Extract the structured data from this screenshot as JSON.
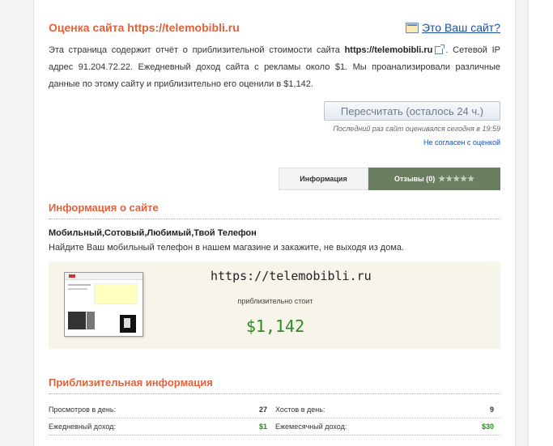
{
  "header": {
    "title": "Оценка сайта https://telemobibli.ru",
    "owner_link": "Это Ваш сайт?"
  },
  "description": {
    "part1": "Эта страница содержит отчёт о приблизительной стоимости сайта ",
    "site_bold": "https://telemobibli.ru",
    "part2": ". Сетевой IP адрес 91.204.72.22. Ежедневный доход сайта с рекламы около $1. Мы проанализировали различные данные по этому сайту и приблизительно его оценили в $1,142."
  },
  "actions": {
    "recalc_label": "Пересчитать (осталось 24 ч.)",
    "last_evaluated": "Последний раз сайт оценивался сегодня в 19:59",
    "disagree_link": "Не согласен с оценкой"
  },
  "tabs": {
    "info_label": "Информация",
    "reviews_label": "Отзывы (0)",
    "stars": "★★★★★"
  },
  "site_info": {
    "heading": "Информация о сайте",
    "site_title": "Мобильный,Сотовый,Любимый,Твой Телефон",
    "site_description": "Найдите Ваш мобильный телефон в нашем магазине и закажите, не выходя из дома."
  },
  "valuation": {
    "url": "https://telemobibli.ru",
    "label": "приблизительно стоит",
    "value": "$1,142"
  },
  "approx": {
    "heading": "Приблизительная информация",
    "rows": [
      {
        "l_label": "Просмотров в день:",
        "l_value": "27",
        "r_label": "Хостов в день:",
        "r_value": "9"
      },
      {
        "l_label": "Ежедневный доход:",
        "l_value": "$1",
        "r_label": "Ежемесячный доход:",
        "r_value": "$30"
      }
    ]
  },
  "colors": {
    "accent": "#e0613a",
    "link": "#1a4ea5",
    "money": "#2a8a23",
    "tab_active": "#6a7e60"
  }
}
